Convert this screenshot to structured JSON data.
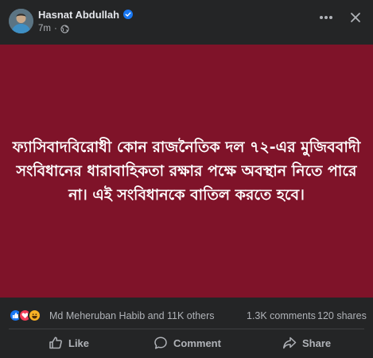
{
  "post": {
    "author": "Hasnat Abdullah",
    "time": "7m",
    "separator": "·",
    "text": "ফ্যাসিবাদবিরোধী কোন রাজনৈতিক দল ৭২-এর মুজিববাদী সংবিধানের ধারাবাহিকতা রক্ষার পক্ষে অবস্থান নিতে পারে না। এই সংবিধানকে বাতিল করতে হবে।",
    "background_color": "#7f1329"
  },
  "engagement": {
    "reactions": [
      "like",
      "love",
      "haha"
    ],
    "reactors_text": "Md Meheruban Habib and 11K others",
    "comments": "1.3K comments",
    "shares": "120 shares"
  },
  "actions": {
    "like": "Like",
    "comment": "Comment",
    "share": "Share"
  },
  "icons": {
    "verified": "verified-badge-icon",
    "privacy": "globe-icon",
    "more": "more-options-icon",
    "close": "close-icon"
  },
  "colors": {
    "surface": "#242526",
    "text_primary": "#e4e6eb",
    "text_secondary": "#b0b3b8",
    "verified": "#1877f2"
  }
}
